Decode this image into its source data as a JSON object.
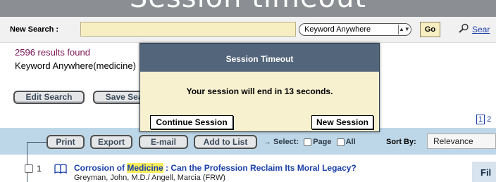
{
  "banner": {
    "title": "Session timeout"
  },
  "new_search": {
    "label": "New Search :",
    "input_value": "",
    "field_select": "Keyword Anywhere",
    "go_label": "Go",
    "link_label": "Sear"
  },
  "results": {
    "count_text": "2596 results found",
    "query_text": "Keyword Anywhere(medicine)"
  },
  "buttons": {
    "edit_search": "Edit Search",
    "save_search": "Save Search"
  },
  "pagination": {
    "current": "1",
    "next": "2"
  },
  "action_bar": {
    "print": "Print",
    "export": "Export",
    "email": "E-mail",
    "add_to_list": "Add to List",
    "select_label": "→ Select:",
    "page_label": "Page",
    "all_label": "All",
    "sort_by_label": "Sort By:",
    "sort_value": "Relevance"
  },
  "result_rows": [
    {
      "number": "1",
      "title_before": "Corrosion of ",
      "title_highlight": "Medicine",
      "title_after": " : Can the Profession Reclaim Its Moral Legacy?",
      "authors": "Greyman, John, M.D./ Angell, Marcia (FRW)"
    }
  ],
  "filter_label": "Fil",
  "modal": {
    "title": "Session Timeout",
    "message": "Your session will end in 13 seconds.",
    "continue_label": "Continue Session",
    "new_label": "New Session"
  },
  "colors": {
    "modal_header": "#53657a",
    "modal_body": "#f7f1d0",
    "action_bar": "#bed7e8",
    "link": "#1a3fa8",
    "results_count": "#7b1357",
    "highlight": "#f8ed5b"
  },
  "icons": {
    "search_link_icon": "magnifier-icon",
    "result_type_icon": "book-icon"
  }
}
